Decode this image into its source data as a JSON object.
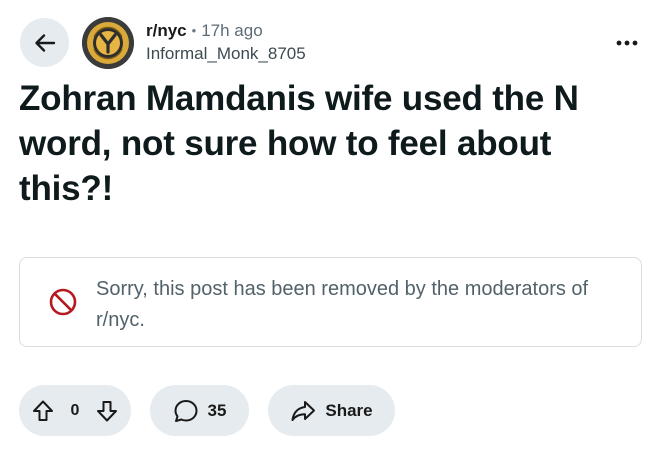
{
  "post": {
    "subreddit": "r/nyc",
    "separator": "•",
    "time_ago": "17h ago",
    "author": "Informal_Monk_8705",
    "title": "Zohran Mamdanis wife used the N word, not sure how to feel about this?!"
  },
  "notice": {
    "message": "Sorry, this post has been removed by the moderators of r/nyc.",
    "icon": "removed-circle-icon",
    "icon_color": "#b3191f"
  },
  "actions": {
    "vote_count": "0",
    "comment_count": "35",
    "share_label": "Share"
  },
  "icons": {
    "back": "arrow-left-icon",
    "more": "overflow-dots-icon",
    "upvote": "arrow-up-icon",
    "downvote": "arrow-down-icon",
    "comment": "speech-bubble-icon",
    "share": "share-arrow-icon"
  },
  "colors": {
    "pill_background": "#e5ebee",
    "text_primary": "#0f1a1c",
    "text_muted": "#5c6c74"
  }
}
